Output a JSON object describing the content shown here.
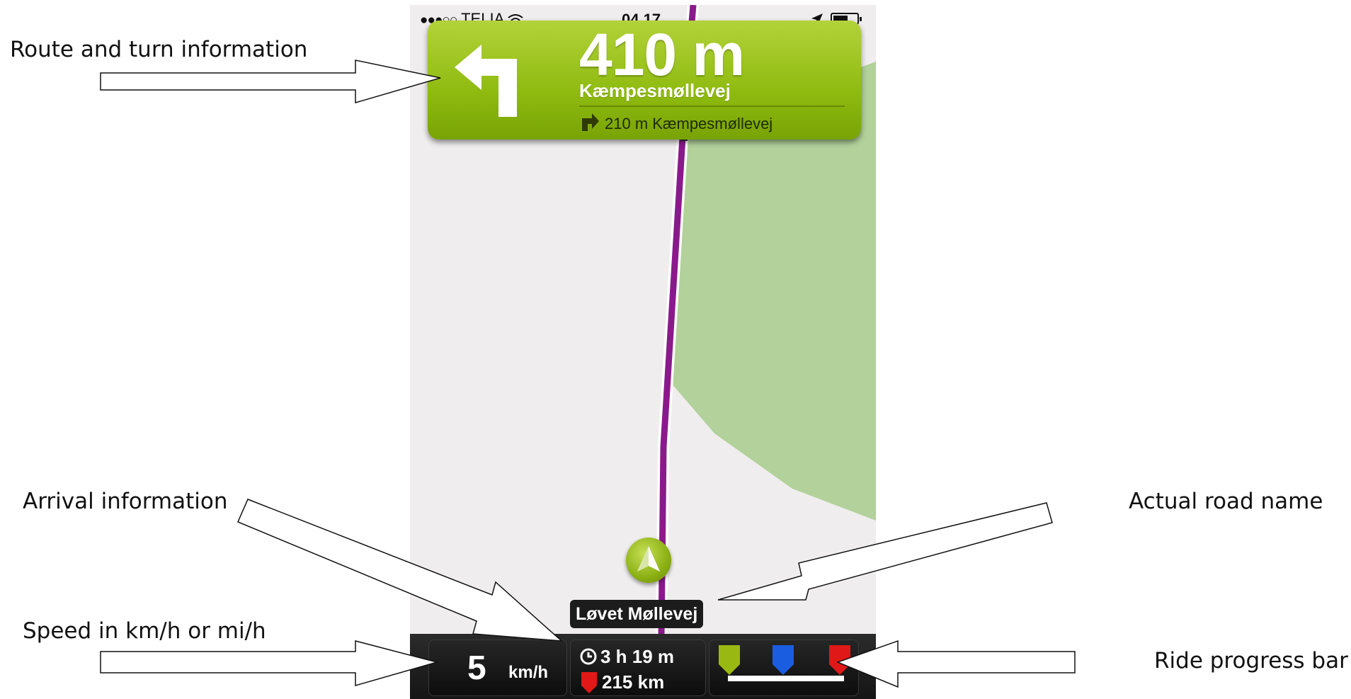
{
  "callouts": {
    "route_turn": "Route and turn information",
    "arrival": "Arrival information",
    "speed": "Speed in km/h or mi/h",
    "road_name": "Actual road name",
    "progress": "Ride progress bar"
  },
  "status_bar": {
    "signal_dots": "●●●○○",
    "carrier": "TELIA",
    "wifi_icon": "wifi-icon",
    "time": "04.17",
    "location_icon": "location-arrow-icon",
    "battery_icon": "battery-icon"
  },
  "turn_info": {
    "distance": "410 m",
    "street": "Kæmpesmøllevej",
    "next_turn_text": "210 m Kæmpesmøllevej",
    "turn_icon": "turn-left-arrow-icon",
    "next_turn_icon": "turn-right-arrow-icon"
  },
  "map": {
    "road_label": "Løvet Møllevej",
    "route_color": "#8a1a8c",
    "park_color": "#b2d19b",
    "background_color": "#efeded"
  },
  "bottom_bar": {
    "speed_value": "5",
    "speed_unit": "km/h",
    "arrival_time": "3 h 19 m",
    "remaining_distance": "215 km",
    "progress_flags": [
      "start-flag-green",
      "current-flag-blue",
      "destination-flag-red"
    ]
  },
  "colors": {
    "turn_panel_green": "#8fbb10",
    "flag_green": "#9ab812",
    "flag_blue": "#1a5de0",
    "flag_red": "#e01818"
  }
}
